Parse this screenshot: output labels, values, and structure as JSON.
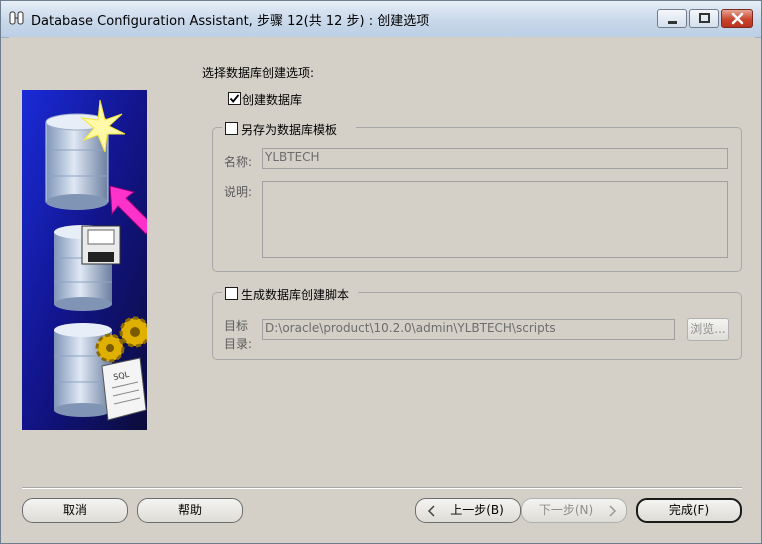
{
  "window": {
    "title": "Database Configuration Assistant, 步骤 12(共 12 步) : 创建选项"
  },
  "main": {
    "heading": "选择数据库创建选项:",
    "create_db": {
      "label": "创建数据库",
      "checked": true
    },
    "template_group": {
      "label": "另存为数据库模板",
      "checked": false,
      "name_label": "名称:",
      "name_value": "YLBTECH",
      "desc_label": "说明:",
      "desc_value": ""
    },
    "script_group": {
      "label": "生成数据库创建脚本",
      "checked": false,
      "dir_label_line1": "目标",
      "dir_label_line2": "目录:",
      "dir_value": "D:\\oracle\\product\\10.2.0\\admin\\YLBTECH\\scripts",
      "browse_label": "浏览..."
    }
  },
  "buttons": {
    "cancel": "取消",
    "help": "帮助",
    "back": "上一步(B)",
    "next": "下一步(N)",
    "finish": "完成(F)"
  },
  "icons": [
    "database-app-icon",
    "minimize-icon",
    "maximize-icon",
    "close-icon",
    "checkmark-icon",
    "chevron-left-icon",
    "chevron-right-icon"
  ],
  "colors": {
    "art_background": "#1a1a78",
    "arrow": "#ff33cc",
    "accent_title": "#c9d8ea"
  }
}
